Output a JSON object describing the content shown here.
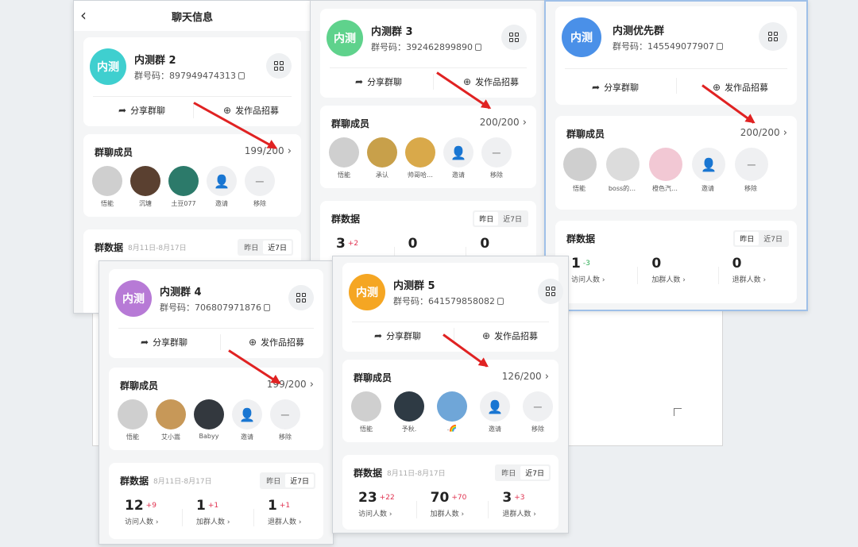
{
  "screens": [
    {
      "page_title": "聊天信息",
      "group": {
        "avatar_text": "内测",
        "avatar_color": "#3fcfcf",
        "name": "内测群 2",
        "id_label": "群号码：897949474313"
      },
      "actions": {
        "share": "分享群聊",
        "post": "发作品招募"
      },
      "members": {
        "title": "群聊成员",
        "count": "199/200",
        "list": [
          {
            "label": "悟能",
            "color": "#cfcfcf"
          },
          {
            "label": "沉塘",
            "color": "#5a4030"
          },
          {
            "label": "土豆077",
            "color": "#2c7a6a"
          }
        ],
        "invite": "邀请",
        "remove": "移除"
      },
      "stats": {
        "title": "群数据",
        "range": "8月11日-8月17日",
        "yesterday": "昨日",
        "week": "近7日"
      }
    },
    {
      "group": {
        "avatar_text": "内测",
        "avatar_color": "#5fd28c",
        "name": "内测群 3",
        "id_label": "群号码：392462899890"
      },
      "actions": {
        "share": "分享群聊",
        "post": "发作品招募"
      },
      "members": {
        "title": "群聊成员",
        "count": "200/200",
        "list": [
          {
            "label": "悟能",
            "color": "#cfcfcf"
          },
          {
            "label": "承认",
            "color": "#c8a04a"
          },
          {
            "label": "帅哥哈…",
            "color": "#d9a94a"
          }
        ],
        "invite": "邀请",
        "remove": "移除"
      },
      "stats": {
        "title": "群数据",
        "yesterday": "昨日",
        "week": "近7日",
        "items": [
          {
            "num": "3",
            "delta": "+2",
            "dir": "up"
          },
          {
            "num": "0",
            "delta": "",
            "dir": ""
          },
          {
            "num": "0",
            "delta": "",
            "dir": ""
          }
        ]
      }
    },
    {
      "group": {
        "avatar_text": "内测",
        "avatar_color": "#4a90e8",
        "name": "内测优先群",
        "id_label": "群号码：145549077907"
      },
      "actions": {
        "share": "分享群聊",
        "post": "发作品招募"
      },
      "members": {
        "title": "群聊成员",
        "count": "200/200",
        "list": [
          {
            "label": "悟能",
            "color": "#cfcfcf"
          },
          {
            "label": "boss的…",
            "color": "#dcdcdc"
          },
          {
            "label": "橙色汽…",
            "color": "#f2c8d4"
          }
        ],
        "invite": "邀请",
        "remove": "移除"
      },
      "stats": {
        "title": "群数据",
        "yesterday": "昨日",
        "week": "近7日",
        "items": [
          {
            "num": "1",
            "delta": "-3",
            "dir": "down",
            "cap": "访问人数"
          },
          {
            "num": "0",
            "delta": "",
            "dir": "",
            "cap": "加群人数"
          },
          {
            "num": "0",
            "delta": "",
            "dir": "",
            "cap": "退群人数"
          }
        ]
      }
    },
    {
      "group": {
        "avatar_text": "内测",
        "avatar_color": "#b77ad6",
        "name": "内测群 4",
        "id_label": "群号码：706807971876"
      },
      "actions": {
        "share": "分享群聊",
        "post": "发作品招募"
      },
      "members": {
        "title": "群聊成员",
        "count": "199/200",
        "list": [
          {
            "label": "悟能",
            "color": "#cfcfcf"
          },
          {
            "label": "艾小嵩",
            "color": "#c79858"
          },
          {
            "label": "Babyy",
            "color": "#33383e"
          }
        ],
        "invite": "邀请",
        "remove": "移除"
      },
      "stats": {
        "title": "群数据",
        "range": "8月11日-8月17日",
        "yesterday": "昨日",
        "week": "近7日",
        "items": [
          {
            "num": "12",
            "delta": "+9",
            "dir": "up",
            "cap": "访问人数"
          },
          {
            "num": "1",
            "delta": "+1",
            "dir": "up",
            "cap": "加群人数"
          },
          {
            "num": "1",
            "delta": "+1",
            "dir": "up",
            "cap": "退群人数"
          }
        ]
      }
    },
    {
      "group": {
        "avatar_text": "内测",
        "avatar_color": "#f5a623",
        "name": "内测群 5",
        "id_label": "群号码：641579858082"
      },
      "actions": {
        "share": "分享群聊",
        "post": "发作品招募"
      },
      "members": {
        "title": "群聊成员",
        "count": "126/200",
        "list": [
          {
            "label": "悟能",
            "color": "#cfcfcf"
          },
          {
            "label": "予秋.",
            "color": "#2e3a44"
          },
          {
            "label": ".🌈",
            "color": "#6fa6d8"
          }
        ],
        "invite": "邀请",
        "remove": "移除"
      },
      "stats": {
        "title": "群数据",
        "range": "8月11日-8月17日",
        "yesterday": "昨日",
        "week": "近7日",
        "items": [
          {
            "num": "23",
            "delta": "+22",
            "dir": "up",
            "cap": "访问人数"
          },
          {
            "num": "70",
            "delta": "+70",
            "dir": "up",
            "cap": "加群人数"
          },
          {
            "num": "3",
            "delta": "+3",
            "dir": "up",
            "cap": "退群人数"
          }
        ]
      }
    }
  ],
  "icons": {
    "back": "chevron-left-icon",
    "share": "share-icon",
    "upload": "upload-circle-icon",
    "qr": "qr-code-icon",
    "invite": "add-user-icon",
    "remove": "minus-icon",
    "copy": "copy-icon"
  },
  "colors": {
    "increase": "#e0314f",
    "decrease": "#2fae56",
    "annotation_arrow": "#e02222"
  }
}
